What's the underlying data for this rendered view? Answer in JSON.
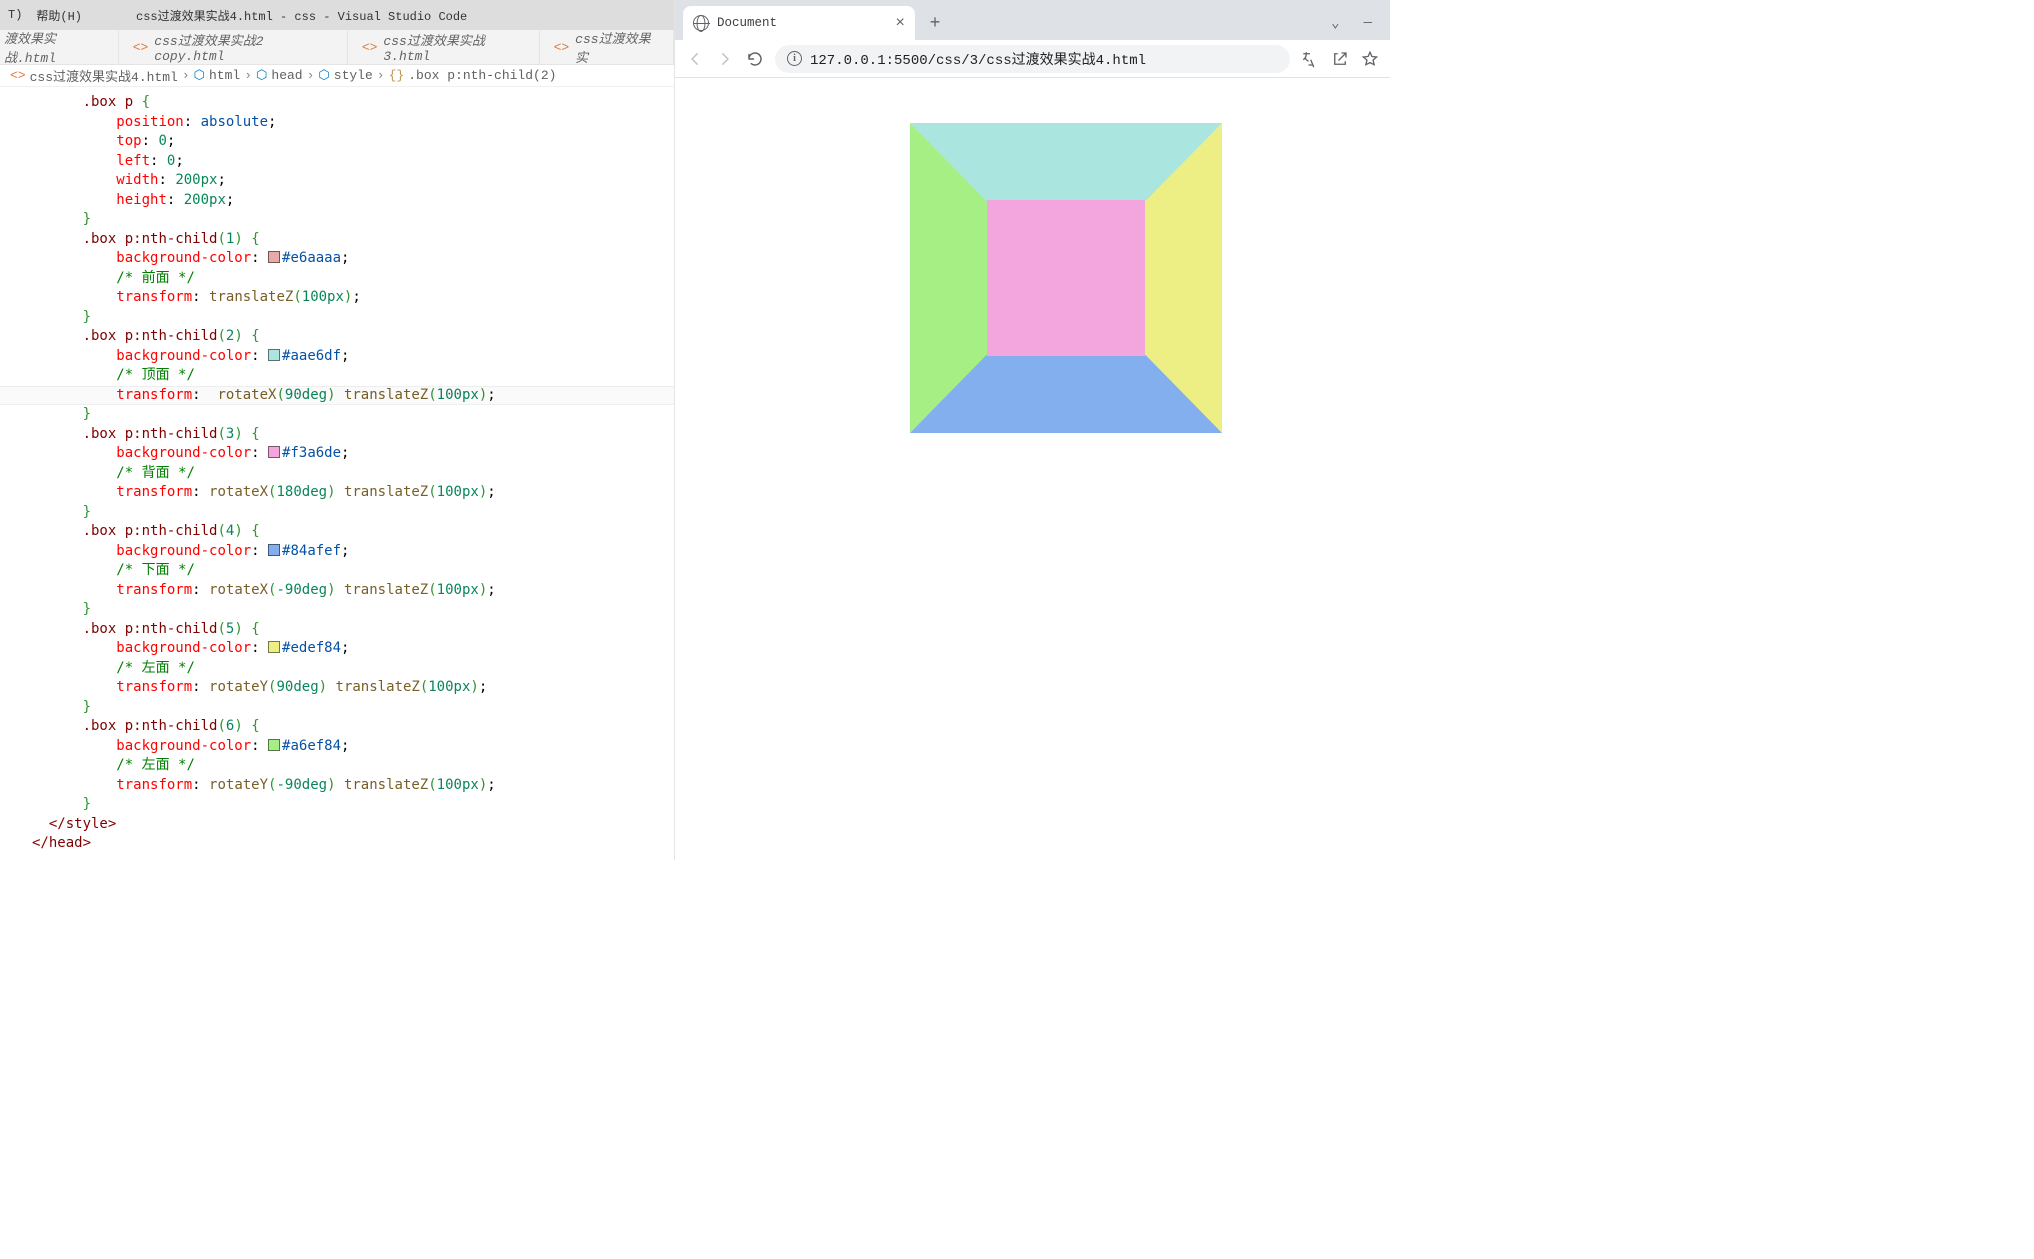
{
  "vscode": {
    "menu_partial": "T)",
    "menu_help": "帮助(H)",
    "title": "css过渡效果实战4.html - css - Visual Studio Code",
    "tabs": [
      {
        "label": "渡效果实战.html"
      },
      {
        "label": "css过渡效果实战2 copy.html"
      },
      {
        "label": "css过渡效果实战3.html"
      },
      {
        "label": "css过渡效果实"
      }
    ],
    "breadcrumbs": {
      "file": "css过渡效果实战4.html",
      "b1": "html",
      "b2": "head",
      "b3": "style",
      "b4": ".box p:nth-child(2)"
    },
    "code": {
      "colors": {
        "c1": "#e6aaaa",
        "c2": "#aae6df",
        "c3": "#f3a6de",
        "c4": "#84afef",
        "c5": "#edef84",
        "c6": "#a6ef84"
      }
    }
  },
  "chrome": {
    "tab_title": "Document",
    "url": "127.0.0.1:5500/css/3/css过渡效果实战4.html"
  },
  "cube": {
    "top": "#aae6df",
    "bottom": "#84afef",
    "left": "#a6ef84",
    "right": "#edef84",
    "back": "#f3a6de",
    "front": "#e6aaaa"
  }
}
